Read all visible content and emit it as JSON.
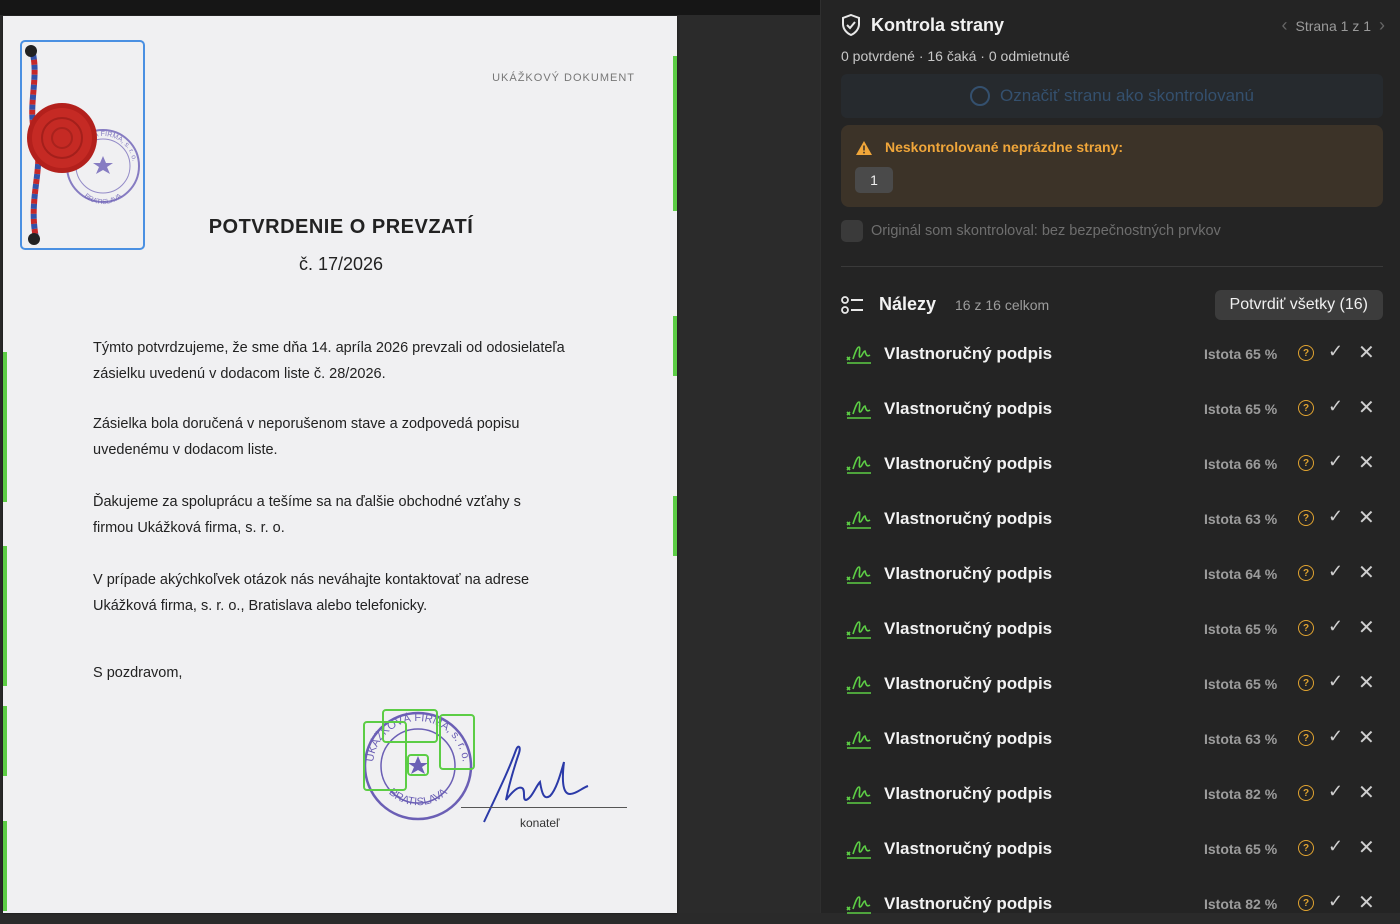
{
  "document": {
    "label": "UKÁŽKOVÝ DOKUMENT",
    "title": "POTVRDENIE O PREVZATÍ",
    "number": "č. 17/2026",
    "paragraphs": [
      "Týmto potvrdzujeme, že sme dňa 14. apríla 2026 prevzali od odosielateľa zásielku uvedenú v dodacom liste č. 28/2026.",
      "Zásielka bola doručená v neporušenom stave a zodpovedá popisu uvedenému v dodacom liste.",
      "Ďakujeme za spoluprácu a tešíme sa na ďalšie obchodné vzťahy s firmou Ukážková firma, s. r. o.",
      "V prípade akýchkoľvek otázok nás neváhajte kontaktovať na adrese Ukážková firma, s. r. o., Bratislava alebo telefonicky."
    ],
    "closing": "S pozdravom,",
    "signer_role": "konateľ",
    "stamp_text_top": "UKÁŽKOVÁ FIRMA, s. r. o.",
    "stamp_text_bottom": "BRATISLAVA",
    "seal_stamp_top": "UKÁŽKOVÁ FIRMA, s. r. o.",
    "seal_stamp_bottom": "BRATISLAVA"
  },
  "panel": {
    "title": "Kontrola strany",
    "pager": "Strana 1 z 1",
    "status": "0 potvrdené · 16 čaká · 0 odmietnuté",
    "mark_button": "Označiť stranu ako skontrolovanú",
    "warning": {
      "text": "Neskontrolované neprázdne strany:",
      "badge": "1"
    },
    "checkbox_label": "Originál som skontroloval: bez bezpečnostných prvkov",
    "findings": {
      "label": "Nálezy",
      "count": "16 z 16 celkom",
      "confirm_all": "Potvrdiť všetky (16)",
      "items": [
        {
          "name": "Vlastnoručný podpis",
          "confidence": "Istota 65 %"
        },
        {
          "name": "Vlastnoručný podpis",
          "confidence": "Istota 65 %"
        },
        {
          "name": "Vlastnoručný podpis",
          "confidence": "Istota 66 %"
        },
        {
          "name": "Vlastnoručný podpis",
          "confidence": "Istota 63 %"
        },
        {
          "name": "Vlastnoručný podpis",
          "confidence": "Istota 64 %"
        },
        {
          "name": "Vlastnoručný podpis",
          "confidence": "Istota 65 %"
        },
        {
          "name": "Vlastnoručný podpis",
          "confidence": "Istota 65 %"
        },
        {
          "name": "Vlastnoručný podpis",
          "confidence": "Istota 63 %"
        },
        {
          "name": "Vlastnoručný podpis",
          "confidence": "Istota 82 %"
        },
        {
          "name": "Vlastnoručný podpis",
          "confidence": "Istota 65 %"
        },
        {
          "name": "Vlastnoručný podpis",
          "confidence": "Istota 82 %"
        }
      ]
    }
  },
  "icons": {
    "shield": "shield-check-icon",
    "prev": "chevron-left-icon",
    "next": "chevron-right-icon",
    "warning": "warning-triangle-icon",
    "findings": "checklist-icon",
    "signature": "signature-icon",
    "help": "question-circle-icon",
    "confirm": "check-icon",
    "reject": "close-icon"
  },
  "colors": {
    "accent_green": "#5ccd45",
    "selection_blue": "#4a90e2",
    "warning_orange": "#f0a63a",
    "panel_bg": "#242424",
    "stamp_purple": "#6b5fb5",
    "seal_red": "#b3201c"
  }
}
